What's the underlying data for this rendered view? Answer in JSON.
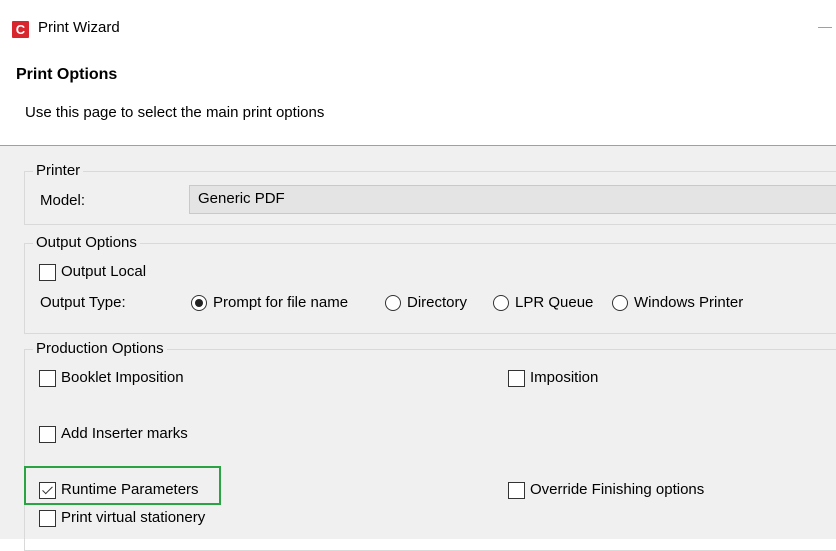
{
  "window": {
    "title": "Print Wizard",
    "logo_letter": "C",
    "minimize_glyph": "—"
  },
  "header": {
    "title": "Print Options",
    "description": "Use this page to select the main print options"
  },
  "printer": {
    "group_label": "Printer",
    "model_label": "Model:",
    "model_value": "Generic PDF"
  },
  "output": {
    "group_label": "Output Options",
    "output_local": {
      "label": "Output Local",
      "checked": false
    },
    "output_type_label": "Output Type:",
    "types": [
      {
        "label": "Prompt for file name",
        "selected": true
      },
      {
        "label": "Directory",
        "selected": false
      },
      {
        "label": "LPR Queue",
        "selected": false
      },
      {
        "label": "Windows Printer",
        "selected": false
      }
    ]
  },
  "production": {
    "group_label": "Production Options",
    "booklet_imposition": {
      "label": "Booklet Imposition",
      "checked": false
    },
    "imposition": {
      "label": "Imposition",
      "checked": false
    },
    "add_inserter_marks": {
      "label": "Add Inserter marks",
      "checked": false
    },
    "runtime_parameters": {
      "label": "Runtime Parameters",
      "checked": true
    },
    "override_finishing": {
      "label": "Override Finishing options",
      "checked": false
    },
    "print_virtual_stationery": {
      "label": "Print virtual stationery",
      "checked": false
    }
  },
  "colors": {
    "logo": "#d8262f",
    "highlight": "#2aa343",
    "panel_background": "#f0f0f0"
  }
}
